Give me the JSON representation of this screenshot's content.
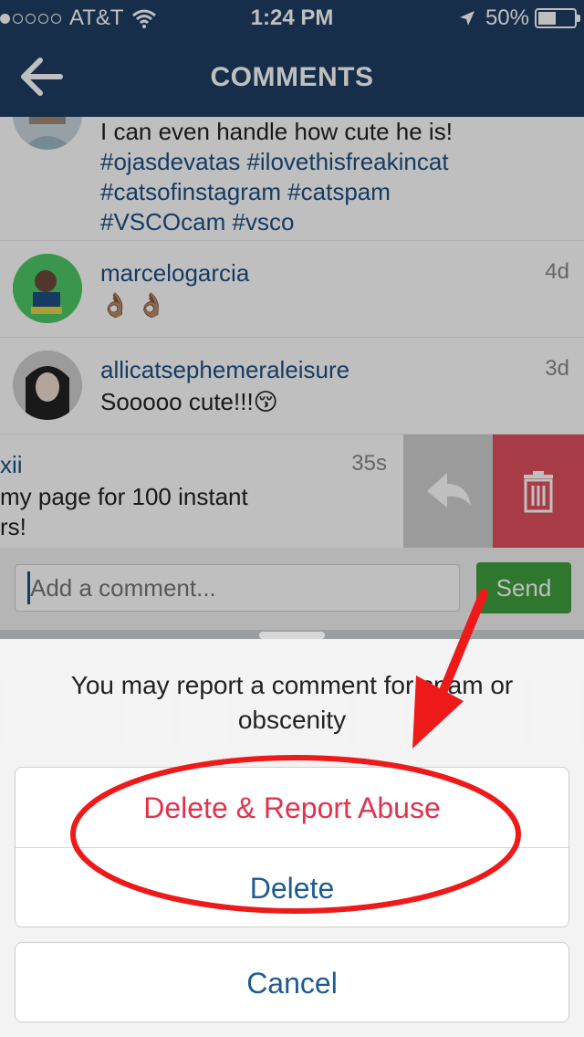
{
  "status_bar": {
    "carrier": "AT&T",
    "time": "1:24 PM",
    "battery": "50%",
    "battery_level": 0.5
  },
  "nav": {
    "title": "COMMENTS",
    "back_icon": "arrow-left-icon"
  },
  "comments": [
    {
      "user": "",
      "time": "",
      "text_plain": "I can even handle how cute he is!",
      "hashtags_line1": "#ojasdevatas #ilovethisfreakincat",
      "hashtags_line2": "#catsofinstagram #catspam",
      "hashtags_line3": "#VSCOcam #vsco"
    },
    {
      "user": "marcelogarcia",
      "time": "4d",
      "text": "👌🏽 👌🏽"
    },
    {
      "user": "allicatsephemeraleisure",
      "time": "3d",
      "text": "Sooooo cute!!!😚"
    },
    {
      "user": "xii",
      "time": "35s",
      "text_line1": "my page for 100 instant",
      "text_line2": "rs!"
    }
  ],
  "swipe_actions": {
    "reply_icon": "reply-icon",
    "delete_icon": "trash-icon"
  },
  "composer": {
    "placeholder": "Add a comment...",
    "send_label": "Send"
  },
  "action_sheet": {
    "message": "You may report a comment for spam or obscenity",
    "report_label": "Delete & Report Abuse",
    "delete_label": "Delete",
    "cancel_label": "Cancel"
  },
  "colors": {
    "nav_bg": "#1e3e63",
    "report": "#e2334d",
    "link_blue": "#1e5b92",
    "annotation_red": "#ee1a1a"
  }
}
